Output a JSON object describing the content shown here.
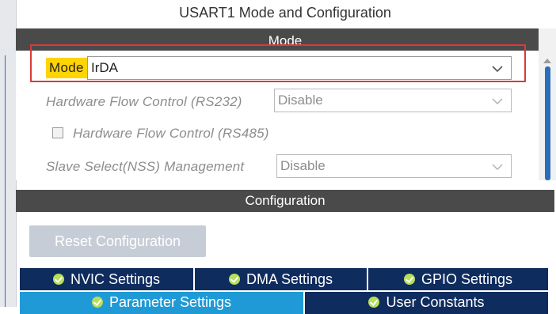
{
  "title": "USART1 Mode and Configuration",
  "mode_section": {
    "header": "Mode",
    "mode": {
      "label": "Mode",
      "value": "IrDA"
    },
    "hw_flow_rs232": {
      "label": "Hardware Flow Control (RS232)",
      "value": "Disable"
    },
    "hw_flow_rs485": {
      "label": "Hardware Flow Control (RS485)",
      "checked": false
    },
    "slave_select": {
      "label": "Slave Select(NSS) Management",
      "value": "Disable"
    }
  },
  "config_section": {
    "header": "Configuration",
    "reset_button": "Reset Configuration",
    "tabs_row1": [
      "NVIC Settings",
      "DMA Settings",
      "GPIO Settings"
    ],
    "tabs_row2": [
      "Parameter Settings",
      "User Constants"
    ],
    "active_tab": "Parameter Settings"
  },
  "colors": {
    "header_bg": "#4a4a4a",
    "tab_bg": "#0f2c5e",
    "tab_active_bg": "#1f9ad6",
    "label_highlight": "#ffd400",
    "focus_outline": "#d83a3a",
    "check_icon": "#b7df5d"
  },
  "icons": [
    "chevron-down-icon",
    "check-circle-icon",
    "checkbox-icon"
  ]
}
